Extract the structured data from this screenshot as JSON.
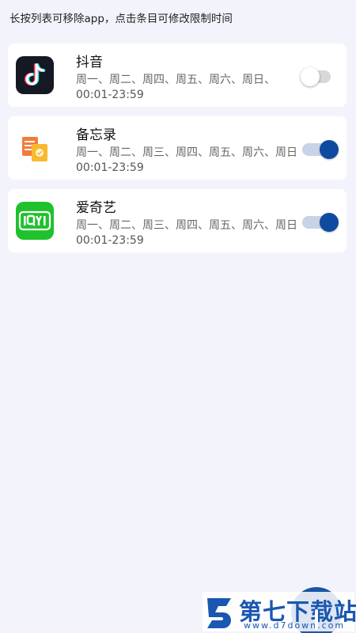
{
  "hint_text": "长按列表可移除app，点击条目可修改限制时间",
  "apps": [
    {
      "name": "抖音",
      "days": "周一、周二、周四、周五、周六、周日、",
      "time": "00:01-23:59",
      "enabled": false,
      "icon": "tiktok-icon"
    },
    {
      "name": "备忘录",
      "days": "周一、周二、周三、周四、周五、周六、周日",
      "time": "00:01-23:59",
      "enabled": true,
      "icon": "memo-icon"
    },
    {
      "name": "爱奇艺",
      "days": "周一、周二、周三、周四、周五、周六、周日",
      "time": "00:01-23:59",
      "enabled": true,
      "icon": "iqiyi-icon"
    }
  ],
  "watermark": {
    "title": "第七下载站",
    "url": "www.d7down.com"
  },
  "colors": {
    "accent": "#0e4ba0",
    "background": "#f3f4fb",
    "card": "#ffffff"
  }
}
